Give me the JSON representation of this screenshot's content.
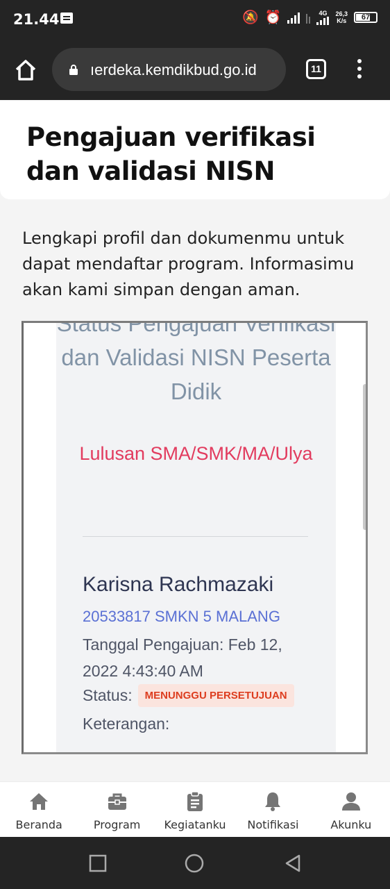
{
  "status_bar": {
    "time": "21.44",
    "network_type": "4G",
    "speed_value": "26,3",
    "speed_unit": "K/s",
    "battery": "67"
  },
  "browser": {
    "url": "ıerdeka.kemdikbud.go.id",
    "tab_count": "11"
  },
  "page": {
    "title": "Pengajuan verifikasi dan validasi NISN",
    "intro": "Lengkapi profil dan dokumenmu untuk dapat mendaftar program. Informasimu akan kami simpan dengan aman."
  },
  "frame": {
    "heading": "Status Pengajuan Verifikasi dan Validasi NISN Peserta Didik",
    "subheading": "Lulusan SMA/SMK/MA/Ulya",
    "student_name": "Karisna Rachmazaki",
    "student_id_school": "20533817 SMKN 5 MALANG",
    "submission_date": "Tanggal Pengajuan: Feb 12, 2022 4:43:40 AM",
    "status_label": "Status:",
    "status_value": "MENUNGGU PERSETUJUAN",
    "note_label": "Keterangan:"
  },
  "colors": {
    "accent_red": "#e23b5e",
    "link_blue": "#5a70d4",
    "badge_bg": "#fbe4de",
    "badge_text": "#dd3d1f"
  },
  "bottom_nav": {
    "items": [
      {
        "label": "Beranda",
        "icon": "home-icon"
      },
      {
        "label": "Program",
        "icon": "briefcase-icon"
      },
      {
        "label": "Kegiatanku",
        "icon": "clipboard-icon"
      },
      {
        "label": "Notifikasi",
        "icon": "bell-icon"
      },
      {
        "label": "Akunku",
        "icon": "user-icon"
      }
    ]
  }
}
